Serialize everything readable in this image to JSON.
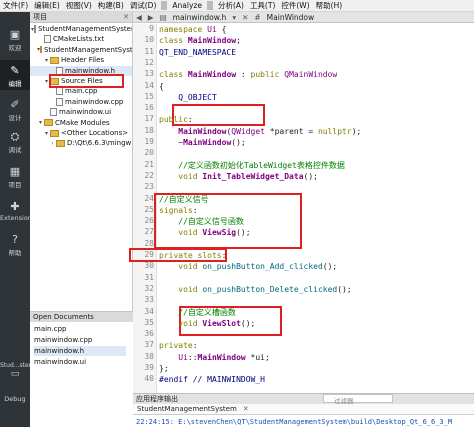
{
  "menubar": {
    "items": [
      "文件(F)",
      "编辑(E)",
      "视图(V)",
      "构建(B)",
      "调试(D)",
      "Analyze",
      "分析(A)",
      "工具(T)",
      "控件(W)",
      "帮助(H)"
    ]
  },
  "modes": [
    {
      "label": "欢迎",
      "icon": "welcome-icon"
    },
    {
      "label": "编辑",
      "icon": "edit-icon"
    },
    {
      "label": "设计",
      "icon": "design-icon"
    },
    {
      "label": "调试",
      "icon": "debug-icon"
    },
    {
      "label": "项目",
      "icon": "project-icon"
    },
    {
      "label": "Extensions",
      "icon": "extensions-icon"
    },
    {
      "label": "帮助",
      "icon": "help-icon"
    }
  ],
  "bottom_kit": {
    "label": "Stud...stem",
    "mode": "Debug"
  },
  "project_panel": {
    "title": "项目",
    "tree": [
      {
        "label": "StudentManagementSystem",
        "depth": 0,
        "arrow": "▾",
        "kind": "project"
      },
      {
        "label": "CMakeLists.txt",
        "depth": 1,
        "arrow": "",
        "kind": "file"
      },
      {
        "label": "StudentManagementSystem",
        "depth": 1,
        "arrow": "▾",
        "kind": "folder"
      },
      {
        "label": "Header Files",
        "depth": 2,
        "arrow": "▾",
        "kind": "folder"
      },
      {
        "label": "mainwindow.h",
        "depth": 3,
        "arrow": "",
        "kind": "file",
        "selected": true
      },
      {
        "label": "Source Files",
        "depth": 2,
        "arrow": "▾",
        "kind": "folder"
      },
      {
        "label": "main.cpp",
        "depth": 3,
        "arrow": "",
        "kind": "file"
      },
      {
        "label": "mainwindow.cpp",
        "depth": 3,
        "arrow": "",
        "kind": "file"
      },
      {
        "label": "mainwindow.ui",
        "depth": 2,
        "arrow": "",
        "kind": "file"
      },
      {
        "label": "CMake Modules",
        "depth": 1,
        "arrow": "▾",
        "kind": "folder"
      },
      {
        "label": "<Other Locations>",
        "depth": 2,
        "arrow": "▾",
        "kind": "folder"
      },
      {
        "label": "D:\\Qt\\6.6.3\\mingw",
        "depth": 3,
        "arrow": "›",
        "kind": "folder"
      }
    ]
  },
  "open_documents": {
    "title": "Open Documents",
    "items": [
      {
        "label": "main.cpp",
        "selected": false
      },
      {
        "label": "mainwindow.cpp",
        "selected": false
      },
      {
        "label": "mainwindow.h",
        "selected": true
      },
      {
        "label": "mainwindow.ui",
        "selected": false
      }
    ]
  },
  "editor": {
    "file_tab": "mainwindow.h",
    "symbol": "MainWindow",
    "line_numbers": [
      "9",
      "10",
      "11",
      "12",
      "13",
      "14",
      "15",
      "16",
      "17",
      "18",
      "19",
      "20",
      "21",
      "22",
      "23",
      "24",
      "25",
      "26",
      "27",
      "28",
      "29",
      "30",
      "31",
      "32",
      "33",
      "34",
      "35",
      "36",
      "37",
      "38",
      "39",
      "40"
    ],
    "lines": [
      [
        {
          "t": "namespace ",
          "c": "kw"
        },
        {
          "t": "Ui",
          "c": "cls"
        },
        {
          "t": " {",
          "c": ""
        }
      ],
      [
        {
          "t": "class ",
          "c": "kw"
        },
        {
          "t": "MainWindow",
          "c": "ty"
        },
        {
          "t": ";",
          "c": ""
        }
      ],
      [
        {
          "t": "QT_END_NAMESPACE",
          "c": "mac"
        }
      ],
      [
        {
          "t": "",
          "c": ""
        }
      ],
      [
        {
          "t": "class ",
          "c": "kw"
        },
        {
          "t": "MainWindow",
          "c": "ty"
        },
        {
          "t": " : ",
          "c": ""
        },
        {
          "t": "public ",
          "c": "kw"
        },
        {
          "t": "QMainWindow",
          "c": "cls"
        }
      ],
      [
        {
          "t": "{",
          "c": ""
        }
      ],
      [
        {
          "t": "    Q_OBJECT",
          "c": "mac"
        }
      ],
      [
        {
          "t": "",
          "c": ""
        }
      ],
      [
        {
          "t": "public",
          "c": "kw"
        },
        {
          "t": ":",
          "c": ""
        }
      ],
      [
        {
          "t": "    ",
          "c": ""
        },
        {
          "t": "MainWindow",
          "c": "ty"
        },
        {
          "t": "(",
          "c": ""
        },
        {
          "t": "QWidget",
          "c": "cls"
        },
        {
          "t": " *parent = ",
          "c": ""
        },
        {
          "t": "nullptr",
          "c": "kw"
        },
        {
          "t": ");",
          "c": ""
        }
      ],
      [
        {
          "t": "    ~",
          "c": ""
        },
        {
          "t": "MainWindow",
          "c": "ty"
        },
        {
          "t": "();",
          "c": ""
        }
      ],
      [
        {
          "t": "",
          "c": ""
        }
      ],
      [
        {
          "t": "    //定义函数初始化TableWidget表格控件数据",
          "c": "cm"
        }
      ],
      [
        {
          "t": "    ",
          "c": ""
        },
        {
          "t": "void ",
          "c": "kw"
        },
        {
          "t": "Init_TableWidget_Data",
          "c": "ty"
        },
        {
          "t": "();",
          "c": ""
        }
      ],
      [
        {
          "t": "",
          "c": ""
        }
      ],
      [
        {
          "t": "//自定义信号",
          "c": "cm"
        }
      ],
      [
        {
          "t": "signals",
          "c": "kw"
        },
        {
          "t": ":",
          "c": ""
        }
      ],
      [
        {
          "t": "    //自定义信号函数",
          "c": "cm"
        }
      ],
      [
        {
          "t": "    ",
          "c": ""
        },
        {
          "t": "void ",
          "c": "kw"
        },
        {
          "t": "ViewSig",
          "c": "ty"
        },
        {
          "t": "();",
          "c": ""
        }
      ],
      [
        {
          "t": "",
          "c": ""
        }
      ],
      [
        {
          "t": "private slots",
          "c": "kw"
        },
        {
          "t": ":",
          "c": ""
        }
      ],
      [
        {
          "t": "    ",
          "c": ""
        },
        {
          "t": "void ",
          "c": "kw"
        },
        {
          "t": "on_pushButton_Add_clicked",
          "c": "fn"
        },
        {
          "t": "();",
          "c": ""
        }
      ],
      [
        {
          "t": "",
          "c": ""
        }
      ],
      [
        {
          "t": "    ",
          "c": ""
        },
        {
          "t": "void ",
          "c": "kw"
        },
        {
          "t": "on_pushButton_Delete_clicked",
          "c": "fn"
        },
        {
          "t": "();",
          "c": ""
        }
      ],
      [
        {
          "t": "",
          "c": ""
        }
      ],
      [
        {
          "t": "    //自定义槽函数",
          "c": "cm"
        }
      ],
      [
        {
          "t": "    ",
          "c": ""
        },
        {
          "t": "void ",
          "c": "kw"
        },
        {
          "t": "ViewSlot",
          "c": "ty"
        },
        {
          "t": "();",
          "c": ""
        }
      ],
      [
        {
          "t": "",
          "c": ""
        }
      ],
      [
        {
          "t": "private",
          "c": "kw"
        },
        {
          "t": ":",
          "c": ""
        }
      ],
      [
        {
          "t": "    ",
          "c": ""
        },
        {
          "t": "Ui",
          "c": "cls"
        },
        {
          "t": "::",
          "c": ""
        },
        {
          "t": "MainWindow",
          "c": "ty"
        },
        {
          "t": " *ui;",
          "c": ""
        }
      ],
      [
        {
          "t": "};",
          "c": ""
        }
      ],
      [
        {
          "t": "#endif // MAINWINDOW_H",
          "c": "pp"
        }
      ]
    ]
  },
  "output": {
    "header": "应用程序输出",
    "filter_placeholder": "过滤器",
    "tab": "StudentManagementSystem",
    "line": "22:24:15: E:\\stevenChen\\QT\\StudentManagementSystem\\build\\Desktop_Qt_6_6_3_M"
  },
  "colors": {
    "highlight_box": "#e02020",
    "modebar": "#2f3438"
  }
}
